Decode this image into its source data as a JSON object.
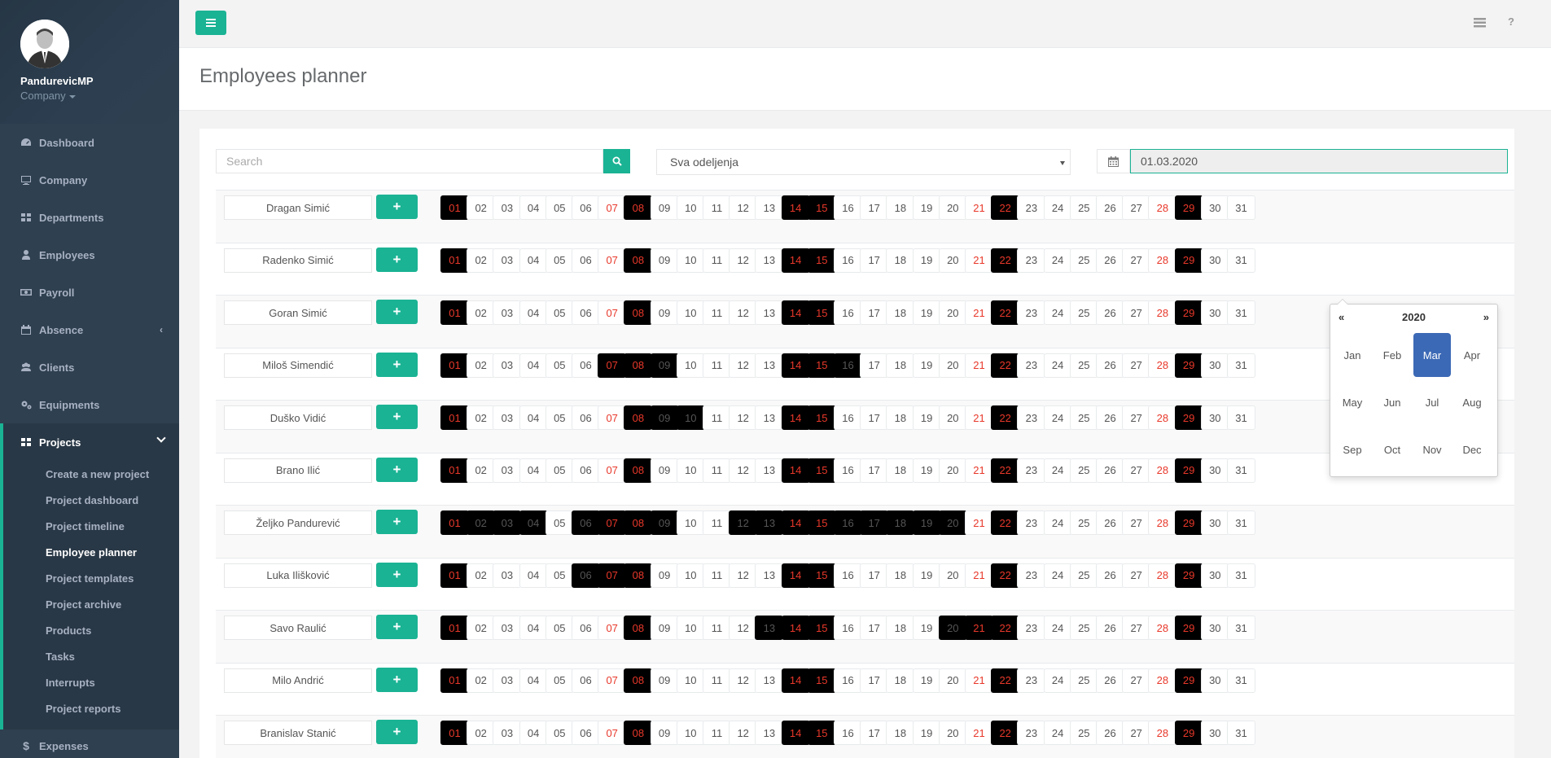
{
  "profile": {
    "name": "PandurevicMP",
    "company": "Company"
  },
  "nav": [
    {
      "label": "Dashboard",
      "icon": "dashboard-icon"
    },
    {
      "label": "Company",
      "icon": "desktop-icon"
    },
    {
      "label": "Departments",
      "icon": "grid-icon"
    },
    {
      "label": "Employees",
      "icon": "user-icon"
    },
    {
      "label": "Payroll",
      "icon": "money-icon"
    },
    {
      "label": "Absence",
      "icon": "calendar-icon"
    },
    {
      "label": "Clients",
      "icon": "users-icon"
    },
    {
      "label": "Equipments",
      "icon": "gears-icon"
    }
  ],
  "projects": {
    "label": "Projects",
    "items": [
      "Create a new project",
      "Project dashboard",
      "Project timeline",
      "Employee planner",
      "Project templates",
      "Project archive",
      "Products",
      "Tasks",
      "Interrupts",
      "Project reports"
    ],
    "active": "Employee planner"
  },
  "expenses": {
    "label": "Expenses"
  },
  "page_title": "Employees planner",
  "search": {
    "placeholder": "Search"
  },
  "department": {
    "value": "Sva odeljenja"
  },
  "date": {
    "value": "01.03.2020"
  },
  "datepicker": {
    "prev": "«",
    "next": "»",
    "year": "2020",
    "months": [
      "Jan",
      "Feb",
      "Mar",
      "Apr",
      "May",
      "Jun",
      "Jul",
      "Aug",
      "Sep",
      "Oct",
      "Nov",
      "Dec"
    ],
    "active": "Mar"
  },
  "add_label": "+",
  "days": [
    "01",
    "02",
    "03",
    "04",
    "05",
    "06",
    "07",
    "08",
    "09",
    "10",
    "11",
    "12",
    "13",
    "14",
    "15",
    "16",
    "17",
    "18",
    "19",
    "20",
    "21",
    "22",
    "23",
    "24",
    "25",
    "26",
    "27",
    "28",
    "29",
    "30",
    "31"
  ],
  "weekend_days": [
    1,
    7,
    8,
    14,
    15,
    21,
    22,
    28,
    29
  ],
  "employees": [
    {
      "name": "Dragan Simić",
      "busy": [
        1,
        8,
        14,
        15,
        22,
        29
      ]
    },
    {
      "name": "Radenko Simić",
      "busy": [
        1,
        8,
        14,
        15,
        22,
        29
      ]
    },
    {
      "name": "Goran Simić",
      "busy": [
        1,
        8,
        14,
        15,
        22,
        29
      ]
    },
    {
      "name": "Miloš Simendić",
      "busy": [
        1,
        7,
        8,
        9,
        14,
        15,
        16,
        22,
        29
      ]
    },
    {
      "name": "Duško Vidić",
      "busy": [
        1,
        8,
        9,
        10,
        14,
        15,
        22,
        29
      ]
    },
    {
      "name": "Brano Ilić",
      "busy": [
        1,
        8,
        14,
        15,
        22,
        29
      ]
    },
    {
      "name": "Željko Pandurević",
      "busy": [
        1,
        2,
        3,
        4,
        6,
        7,
        8,
        9,
        12,
        13,
        14,
        15,
        16,
        17,
        18,
        19,
        20,
        22,
        29
      ]
    },
    {
      "name": "Luka Ilišković",
      "busy": [
        1,
        6,
        7,
        8,
        14,
        15,
        22,
        29
      ]
    },
    {
      "name": "Savo Raulić",
      "busy": [
        1,
        8,
        13,
        14,
        15,
        20,
        21,
        22,
        29
      ]
    },
    {
      "name": "Milo Andrić",
      "busy": [
        1,
        8,
        14,
        15,
        22,
        29
      ]
    },
    {
      "name": "Branislav Stanić",
      "busy": [
        1,
        8,
        14,
        15,
        22,
        29
      ]
    }
  ],
  "colors": {
    "accent": "#1ab394",
    "sidebar": "#2f4050",
    "weekend": "#e8382a",
    "busy": "#000000",
    "picker_active": "#3c69b5"
  }
}
